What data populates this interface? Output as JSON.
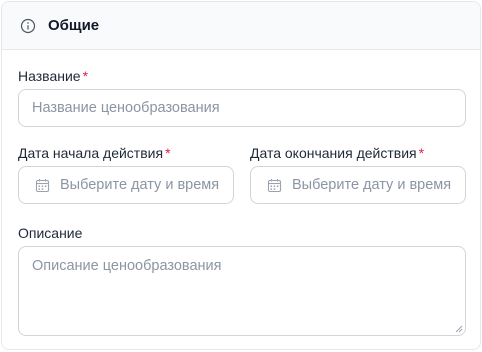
{
  "section": {
    "title": "Общие",
    "icon": "info-icon"
  },
  "fields": {
    "name": {
      "label": "Название",
      "required_mark": "*",
      "placeholder": "Название ценообразования"
    },
    "start_date": {
      "label": "Дата начала действия",
      "required_mark": "*",
      "placeholder": "Выберите дату и время",
      "icon": "calendar-icon"
    },
    "end_date": {
      "label": "Дата окончания действия",
      "required_mark": "*",
      "placeholder": "Выберите дату и время",
      "icon": "calendar-icon"
    },
    "description": {
      "label": "Описание",
      "placeholder": "Описание ценообразования"
    }
  },
  "colors": {
    "required": "#e11d48",
    "border": "#d1d5db",
    "header_bg": "#f9fafb"
  }
}
